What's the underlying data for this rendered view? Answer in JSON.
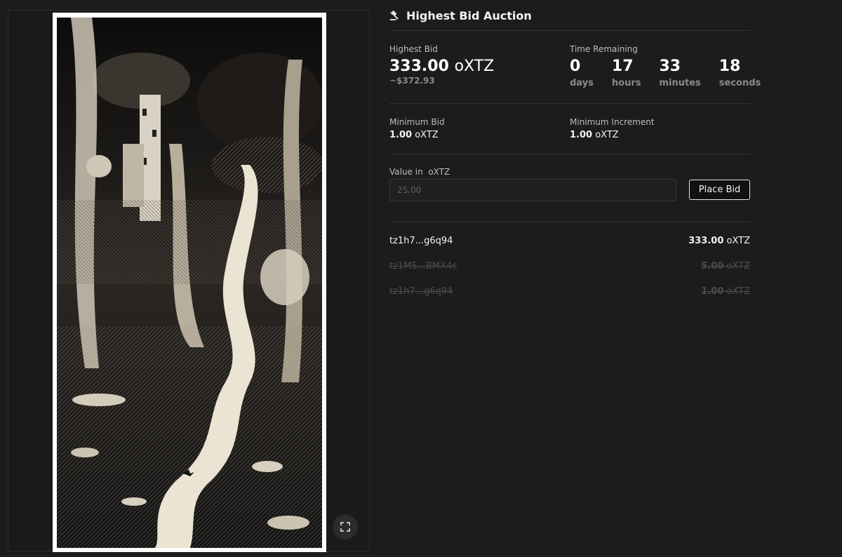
{
  "header": {
    "title": "Highest Bid Auction",
    "icon": "gavel-icon"
  },
  "highest_bid": {
    "label": "Highest Bid",
    "amount": "333.00",
    "currency": "oXTZ",
    "usd": "~$372.93"
  },
  "time_remaining": {
    "label": "Time Remaining",
    "units": [
      {
        "value": "0",
        "label": "days"
      },
      {
        "value": "17",
        "label": "hours"
      },
      {
        "value": "33",
        "label": "minutes"
      },
      {
        "value": "18",
        "label": "seconds"
      }
    ]
  },
  "minimum_bid": {
    "label": "Minimum Bid",
    "amount": "1.00",
    "currency": "oXTZ"
  },
  "minimum_increment": {
    "label": "Minimum Increment",
    "amount": "1.00",
    "currency": "oXTZ"
  },
  "bid_form": {
    "label": "Value in  oXTZ",
    "placeholder": "25.00",
    "button": "Place Bid"
  },
  "bid_history": [
    {
      "bidder": "tz1h7...g6q94",
      "amount": "333.00",
      "currency": "oXTZ",
      "outbid": false
    },
    {
      "bidder": "tz1MS...BMX4s",
      "amount": "5.00",
      "currency": "oXTZ",
      "outbid": true
    },
    {
      "bidder": "tz1h7...g6q94",
      "amount": "1.00",
      "currency": "oXTZ",
      "outbid": true
    }
  ],
  "colors": {
    "background": "#1c1c1c",
    "text": "#e6e6e6",
    "muted": "#8a8a8a",
    "divider": "#333333"
  }
}
